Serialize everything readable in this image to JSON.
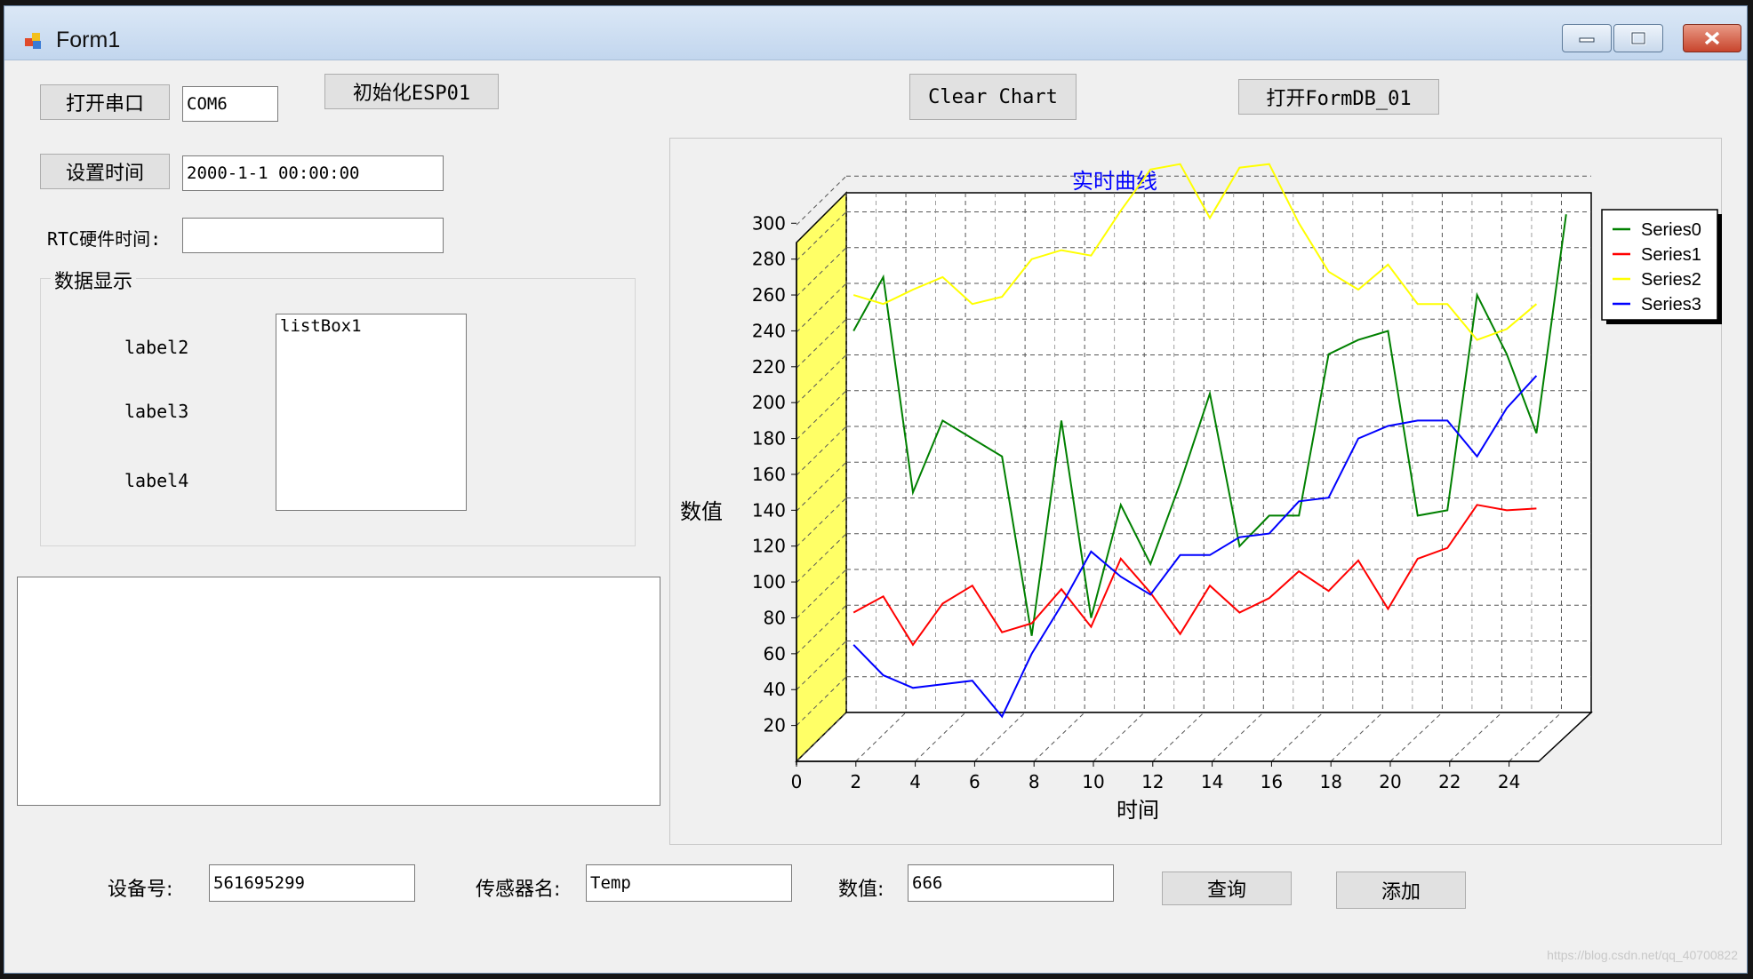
{
  "window": {
    "title": "Form1"
  },
  "controls": {
    "open_port_label": "打开串口",
    "port_value": "COM6",
    "init_esp_label": "初始化ESP01",
    "clear_chart_label": "Clear Chart",
    "open_formdb_label": "打开FormDB_01",
    "set_time_label": "设置时间",
    "time_value": "2000-1-1 00:00:00",
    "rtc_label": "RTC硬件时间:",
    "rtc_value": ""
  },
  "group": {
    "title": "数据显示",
    "label2": "label2",
    "label3": "label3",
    "label4": "label4",
    "listbox_item": "listBox1"
  },
  "bottom": {
    "device_label": "设备号:",
    "device_value": "561695299",
    "sensor_label": "传感器名:",
    "sensor_value": "Temp",
    "value_label": "数值:",
    "value_value": "666",
    "query_label": "查询",
    "add_label": "添加"
  },
  "watermark": "https://blog.csdn.net/qq_40700822",
  "chart_data": {
    "type": "line",
    "title": "实时曲线",
    "xlabel": "时间",
    "ylabel": "数值",
    "xlim": [
      0,
      25
    ],
    "ylim": [
      0,
      315
    ],
    "xticks": [
      0,
      2,
      4,
      6,
      8,
      10,
      12,
      14,
      16,
      18,
      20,
      22,
      24
    ],
    "yticks": [
      20,
      40,
      60,
      80,
      100,
      120,
      140,
      160,
      180,
      200,
      220,
      240,
      260,
      280,
      300
    ],
    "grid": true,
    "legend_position": "top-right",
    "series": [
      {
        "name": "Series0",
        "color": "#008000",
        "x": [
          1,
          2,
          3,
          4,
          5,
          6,
          7,
          8,
          9,
          10,
          11,
          12,
          13,
          14,
          15,
          16,
          17,
          18,
          19,
          20,
          21,
          22,
          23,
          24,
          25
        ],
        "y": [
          225,
          255,
          135,
          175,
          165,
          155,
          55,
          175,
          65,
          128,
          95,
          140,
          190,
          105,
          122,
          122,
          212,
          220,
          225,
          122,
          125,
          245,
          212,
          168,
          290
        ]
      },
      {
        "name": "Series1",
        "color": "#ff0000",
        "x": [
          1,
          2,
          3,
          4,
          5,
          6,
          7,
          8,
          9,
          10,
          11,
          12,
          13,
          14,
          15,
          16,
          17,
          18,
          19,
          20,
          21,
          22,
          23,
          24
        ],
        "y": [
          68,
          77,
          50,
          73,
          83,
          57,
          62,
          81,
          60,
          98,
          79,
          56,
          83,
          68,
          76,
          91,
          80,
          97,
          70,
          98,
          104,
          128,
          125,
          126
        ]
      },
      {
        "name": "Series2",
        "color": "#ffff00",
        "x": [
          1,
          2,
          3,
          4,
          5,
          6,
          7,
          8,
          9,
          10,
          11,
          12,
          13,
          14,
          15,
          16,
          17,
          18,
          19,
          20,
          21,
          22,
          23,
          24
        ],
        "y": [
          245,
          240,
          248,
          255,
          240,
          244,
          265,
          270,
          267,
          292,
          315,
          318,
          288,
          316,
          318,
          285,
          258,
          248,
          262,
          240,
          240,
          220,
          226,
          240
        ]
      },
      {
        "name": "Series3",
        "color": "#0000ff",
        "x": [
          1,
          2,
          3,
          4,
          5,
          6,
          7,
          8,
          9,
          10,
          11,
          12,
          13,
          14,
          15,
          16,
          17,
          18,
          19,
          20,
          21,
          22,
          23,
          24
        ],
        "y": [
          50,
          33,
          26,
          28,
          30,
          10,
          45,
          72,
          102,
          88,
          78,
          100,
          100,
          110,
          112,
          130,
          132,
          165,
          172,
          175,
          175,
          155,
          182,
          200
        ]
      }
    ]
  }
}
